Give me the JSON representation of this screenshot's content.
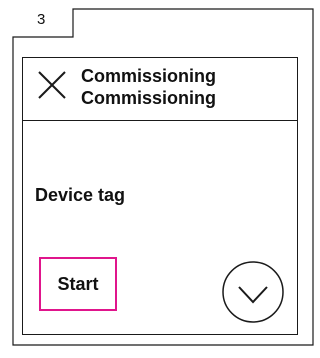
{
  "step": {
    "number": "3"
  },
  "header": {
    "title_line1": "Commissioning",
    "title_line2": "Commissioning"
  },
  "content": {
    "field_label": "Device tag"
  },
  "actions": {
    "start_label": "Start"
  },
  "colors": {
    "highlight": "#e0158c",
    "line": "#1a1a1a"
  },
  "icons": {
    "close": "close-icon",
    "chevron": "chevron-down-icon"
  }
}
